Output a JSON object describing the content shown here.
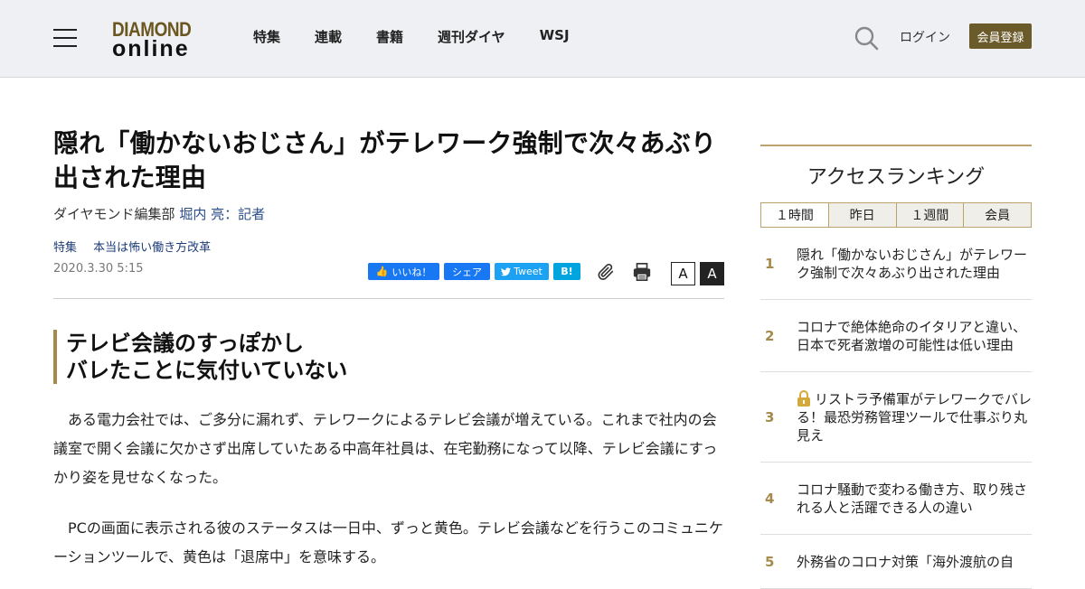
{
  "header": {
    "logo_line1": "DIAMOND",
    "logo_line2": "online",
    "nav": [
      "特集",
      "連載",
      "書籍",
      "週刊ダイヤ",
      "WSJ"
    ],
    "login_label": "ログイン",
    "register_label": "会員登録"
  },
  "article": {
    "title": "隠れ「働かないおじさん」がテレワーク強制で次々あぶり出された理由",
    "byline_prefix": "ダイヤモンド編集部 ",
    "author": "堀内 亮：記者",
    "tags": [
      "特集",
      "本当は怖い働き方改革"
    ],
    "date": "2020.3.30 5:15",
    "social": {
      "like": "いいね！",
      "share": "シェア",
      "tweet": "Tweet",
      "hatena": "B!"
    },
    "font_small_label": "A",
    "font_large_label": "A",
    "subhead_line1": "テレビ会議のすっぽかし",
    "subhead_line2": "バレたことに気付いていない",
    "paragraphs": [
      "ある電力会社では、ご多分に漏れず、テレワークによるテレビ会議が増えている。これまで社内の会議室で開く会議に欠かさず出席していたある中高年社員は、在宅勤務になって以降、テレビ会議にすっかり姿を見せなくなった。",
      "PCの画面に表示される彼のステータスは一日中、ずっと黄色。テレビ会議などを行うこのコミュニケーションツールで、黄色は「退席中」を意味する。"
    ]
  },
  "sidebar": {
    "heading": "アクセスランキング",
    "tabs": [
      "１時間",
      "昨日",
      "１週間",
      "会員"
    ],
    "ranking": [
      {
        "rank": "1",
        "title": "隠れ「働かないおじさん」がテレワーク強制で次々あぶり出された理由",
        "locked": false
      },
      {
        "rank": "2",
        "title": "コロナで絶体絶命のイタリアと違い、日本で死者激増の可能性は低い理由",
        "locked": false
      },
      {
        "rank": "3",
        "title": "リストラ予備軍がテレワークでバレる！最恐労務管理ツールで仕事ぶり丸見え",
        "locked": true
      },
      {
        "rank": "4",
        "title": "コロナ騒動で変わる働き方、取り残される人と活躍できる人の違い",
        "locked": false
      },
      {
        "rank": "5",
        "title": "外務省のコロナ対策「海外渡航の自",
        "locked": false
      }
    ]
  },
  "colors": {
    "brand_gold": "#a58a4b",
    "register_bg": "#6b5a2a",
    "link_blue": "#1f3d7a"
  }
}
